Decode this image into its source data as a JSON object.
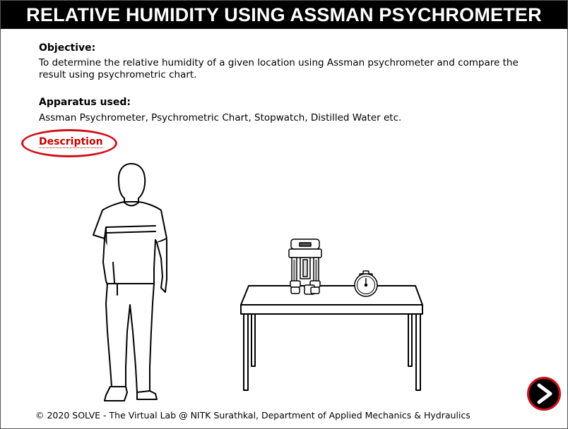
{
  "header": {
    "title": "RELATIVE HUMIDITY USING ASSMAN PSYCHROMETER"
  },
  "objective": {
    "heading": "Objective:",
    "text": "To determine the relative humidity of a given location using Assman psychrometer and compare the result using psychrometric chart."
  },
  "apparatus": {
    "heading": "Apparatus used:",
    "text": "Assman Psychrometer, Psychrometric Chart, Stopwatch, Distilled Water etc."
  },
  "description_link": "Description",
  "footer": {
    "text": "© 2020 SOLVE - The Virtual Lab @ NITK Surathkal, Department of Applied Mechanics & Hydraulics"
  },
  "colors": {
    "title_bg": "#000000",
    "title_text": "#ffffff",
    "link": "#c00000",
    "highlight": "#d0101a"
  },
  "icons": {
    "next": "arrow-right-icon"
  }
}
